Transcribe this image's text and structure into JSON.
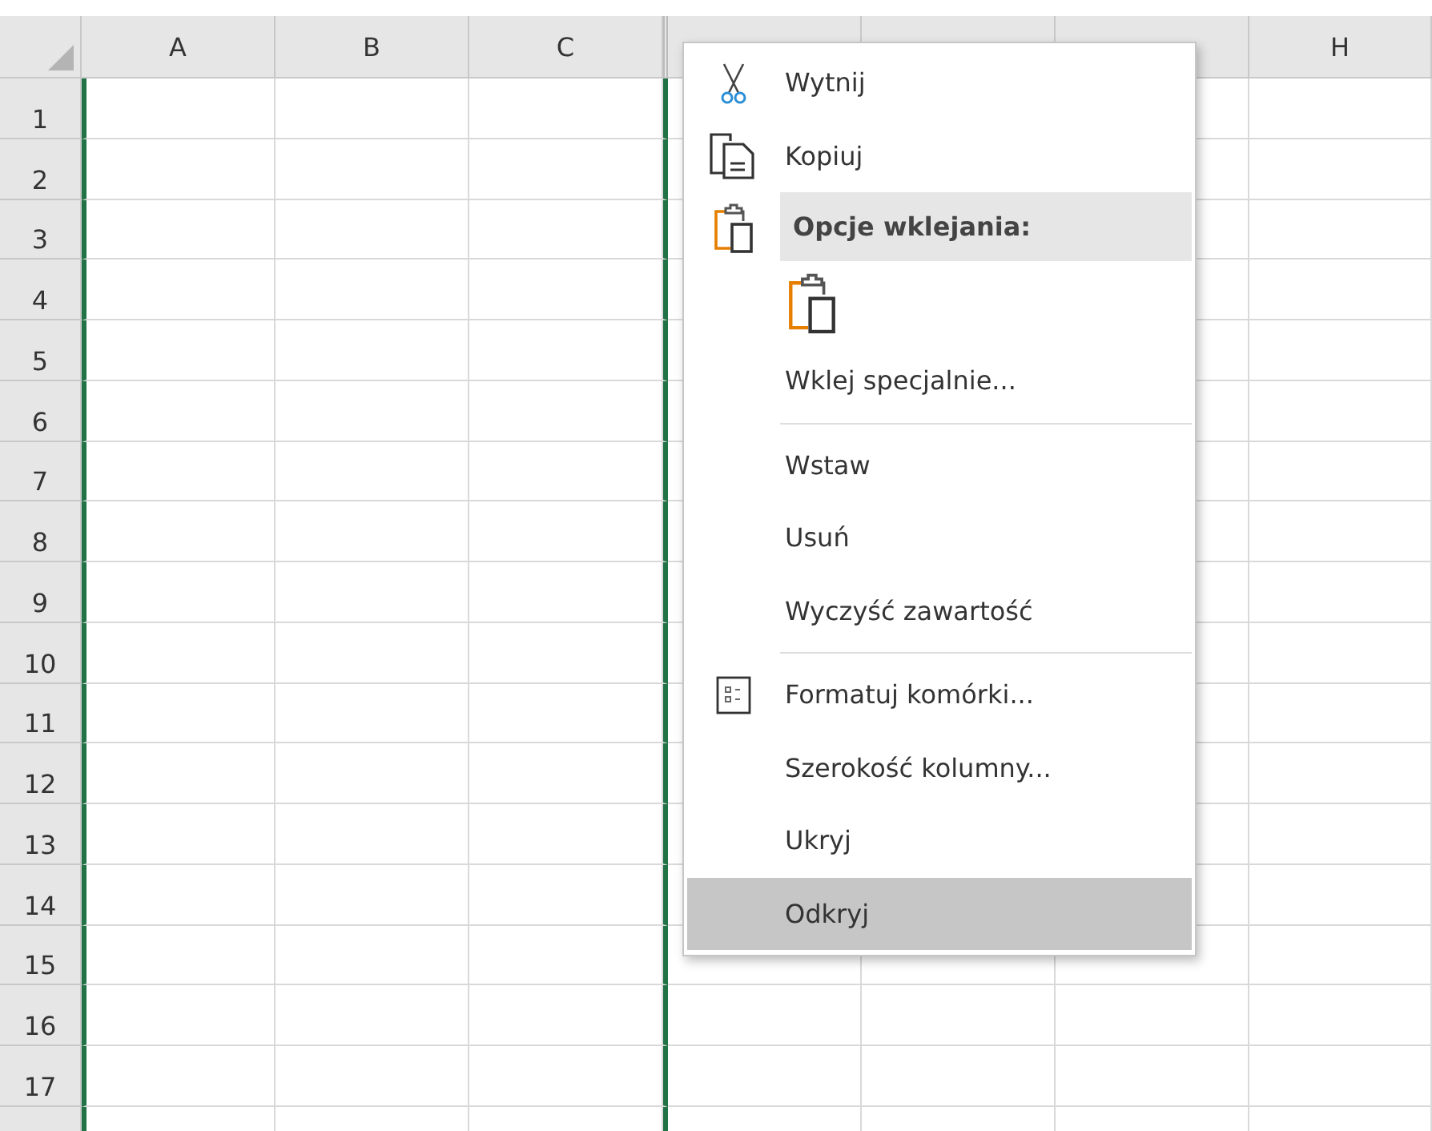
{
  "sheet": {
    "columns": [
      {
        "kind": "normal",
        "label": "A"
      },
      {
        "kind": "normal",
        "label": "B"
      },
      {
        "kind": "normal",
        "label": "C"
      },
      {
        "kind": "hidden"
      },
      {
        "kind": "covered"
      },
      {
        "kind": "covered"
      },
      {
        "kind": "covered"
      },
      {
        "kind": "normal",
        "label": "H"
      }
    ],
    "rows": [
      "1",
      "2",
      "3",
      "4",
      "5",
      "6",
      "7",
      "8",
      "9",
      "10",
      "11",
      "12",
      "13",
      "14",
      "15",
      "16",
      "17"
    ]
  },
  "context_menu": {
    "items": [
      {
        "kind": "cut",
        "label": "Wytnij",
        "highlighted": false
      },
      {
        "kind": "copy",
        "label": "Kopiuj",
        "highlighted": false
      },
      {
        "kind": "header",
        "label": "Opcje wklejania:"
      },
      {
        "kind": "paste-options"
      },
      {
        "kind": "item",
        "label": "Wklej specjalnie...",
        "highlighted": false
      },
      {
        "kind": "separator"
      },
      {
        "kind": "item",
        "label": "Wstaw",
        "highlighted": false
      },
      {
        "kind": "item",
        "label": "Usuń",
        "highlighted": false
      },
      {
        "kind": "item",
        "label": "Wyczyść zawartość",
        "highlighted": false
      },
      {
        "kind": "separator"
      },
      {
        "kind": "format",
        "label": "Formatuj komórki...",
        "highlighted": false
      },
      {
        "kind": "item",
        "label": "Szerokość kolumny...",
        "highlighted": false
      },
      {
        "kind": "item",
        "label": "Ukryj",
        "highlighted": false
      },
      {
        "kind": "item",
        "label": "Odkryj",
        "highlighted": true
      }
    ]
  }
}
